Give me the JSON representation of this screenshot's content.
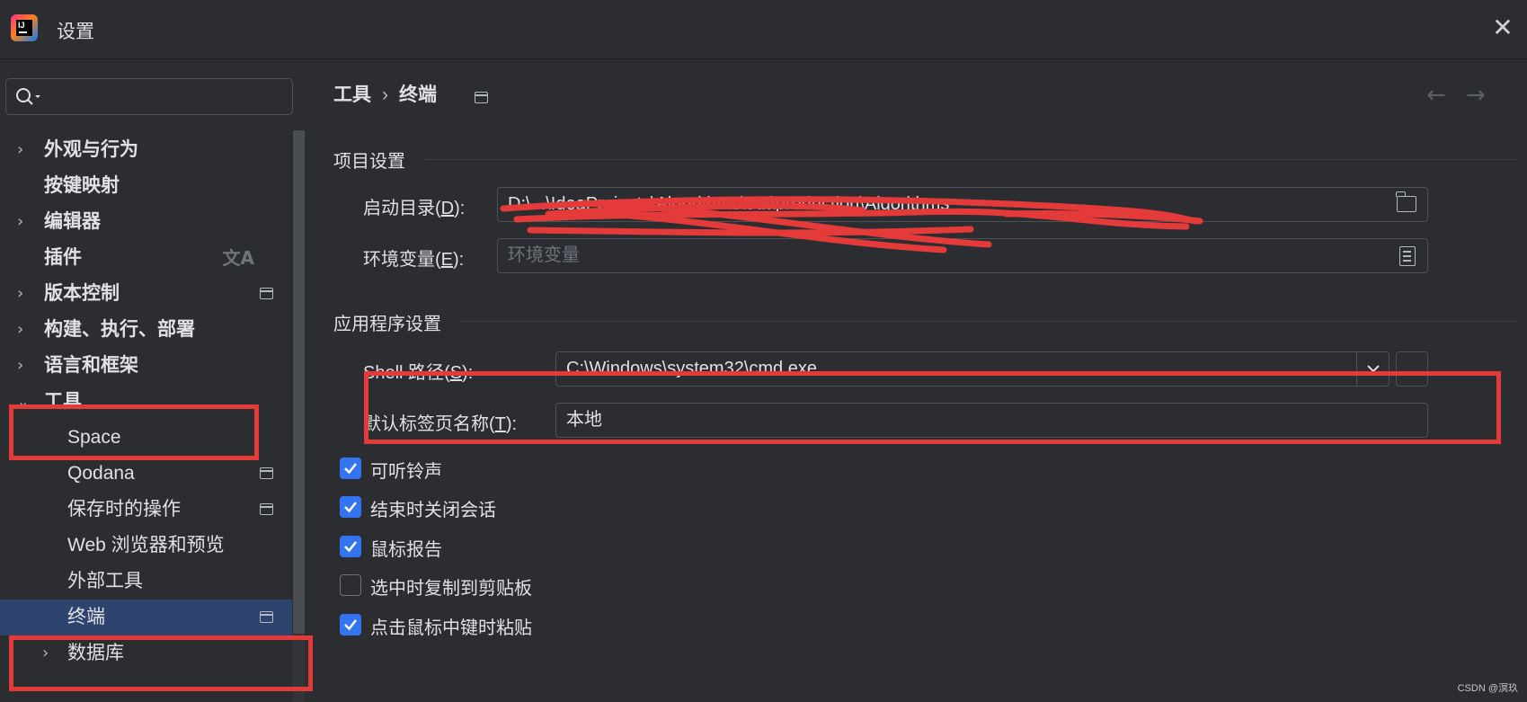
{
  "window": {
    "title": "设置",
    "logo_text": "IJ"
  },
  "search": {
    "placeholder": ""
  },
  "sidebar": {
    "items": [
      {
        "label": "外观与行为",
        "bold": true,
        "expandable": true,
        "expanded": false
      },
      {
        "label": "按键映射",
        "bold": true,
        "expandable": false
      },
      {
        "label": "编辑器",
        "bold": true,
        "expandable": true,
        "expanded": false
      },
      {
        "label": "插件",
        "bold": true,
        "expandable": false,
        "icon": "translate-icon"
      },
      {
        "label": "版本控制",
        "bold": true,
        "expandable": true,
        "expanded": false,
        "icon": "page-icon"
      },
      {
        "label": "构建、执行、部署",
        "bold": true,
        "expandable": true,
        "expanded": false
      },
      {
        "label": "语言和框架",
        "bold": true,
        "expandable": true,
        "expanded": false
      },
      {
        "label": "工具",
        "bold": true,
        "expandable": true,
        "expanded": true
      },
      {
        "label": "Space",
        "bold": false,
        "child": true
      },
      {
        "label": "Qodana",
        "bold": false,
        "child": true,
        "icon": "page-icon"
      },
      {
        "label": "保存时的操作",
        "bold": false,
        "child": true,
        "icon": "page-icon"
      },
      {
        "label": "Web 浏览器和预览",
        "bold": false,
        "child": true
      },
      {
        "label": "外部工具",
        "bold": false,
        "child": true
      },
      {
        "label": "终端",
        "bold": false,
        "child": true,
        "selected": true,
        "icon": "page-icon"
      },
      {
        "label": "数据库",
        "bold": false,
        "child": true,
        "expandable": true
      }
    ]
  },
  "breadcrumb": {
    "parent": "工具",
    "separator": "›",
    "current": "终端"
  },
  "project_settings": {
    "section_title": "项目设置",
    "start_dir": {
      "label_pre": "启动目录(",
      "mnemonic": "D",
      "label_post": "):",
      "value": "D:\\...\\IdeaProjects\\Algorithms\\out\\production\\Algorithms"
    },
    "env_vars": {
      "label_pre": "环境变量(",
      "mnemonic": "E",
      "label_post": "):",
      "placeholder": "环境变量"
    }
  },
  "app_settings": {
    "section_title": "应用程序设置",
    "shell_path": {
      "label_pre": "Shell 路径(",
      "mnemonic": "S",
      "label_post": "):",
      "value": "C:\\Windows\\system32\\cmd.exe",
      "browse_label": ".."
    },
    "default_tab_name": {
      "label_pre": "默认标签页名称(",
      "mnemonic": "T",
      "label_post": "):",
      "value": "本地"
    },
    "checkboxes": [
      {
        "label": "可听铃声",
        "checked": true
      },
      {
        "label": "结束时关闭会话",
        "checked": true
      },
      {
        "label": "鼠标报告",
        "checked": true
      },
      {
        "label": "选中时复制到剪贴板",
        "checked": false
      },
      {
        "label": "点击鼠标中键时粘贴",
        "checked": true
      }
    ]
  },
  "watermark": "CSDN @溟玖",
  "colors": {
    "background": "#2b2d30",
    "selected": "#2e436e",
    "accent": "#3574f0",
    "annotation": "#e53a3a"
  }
}
